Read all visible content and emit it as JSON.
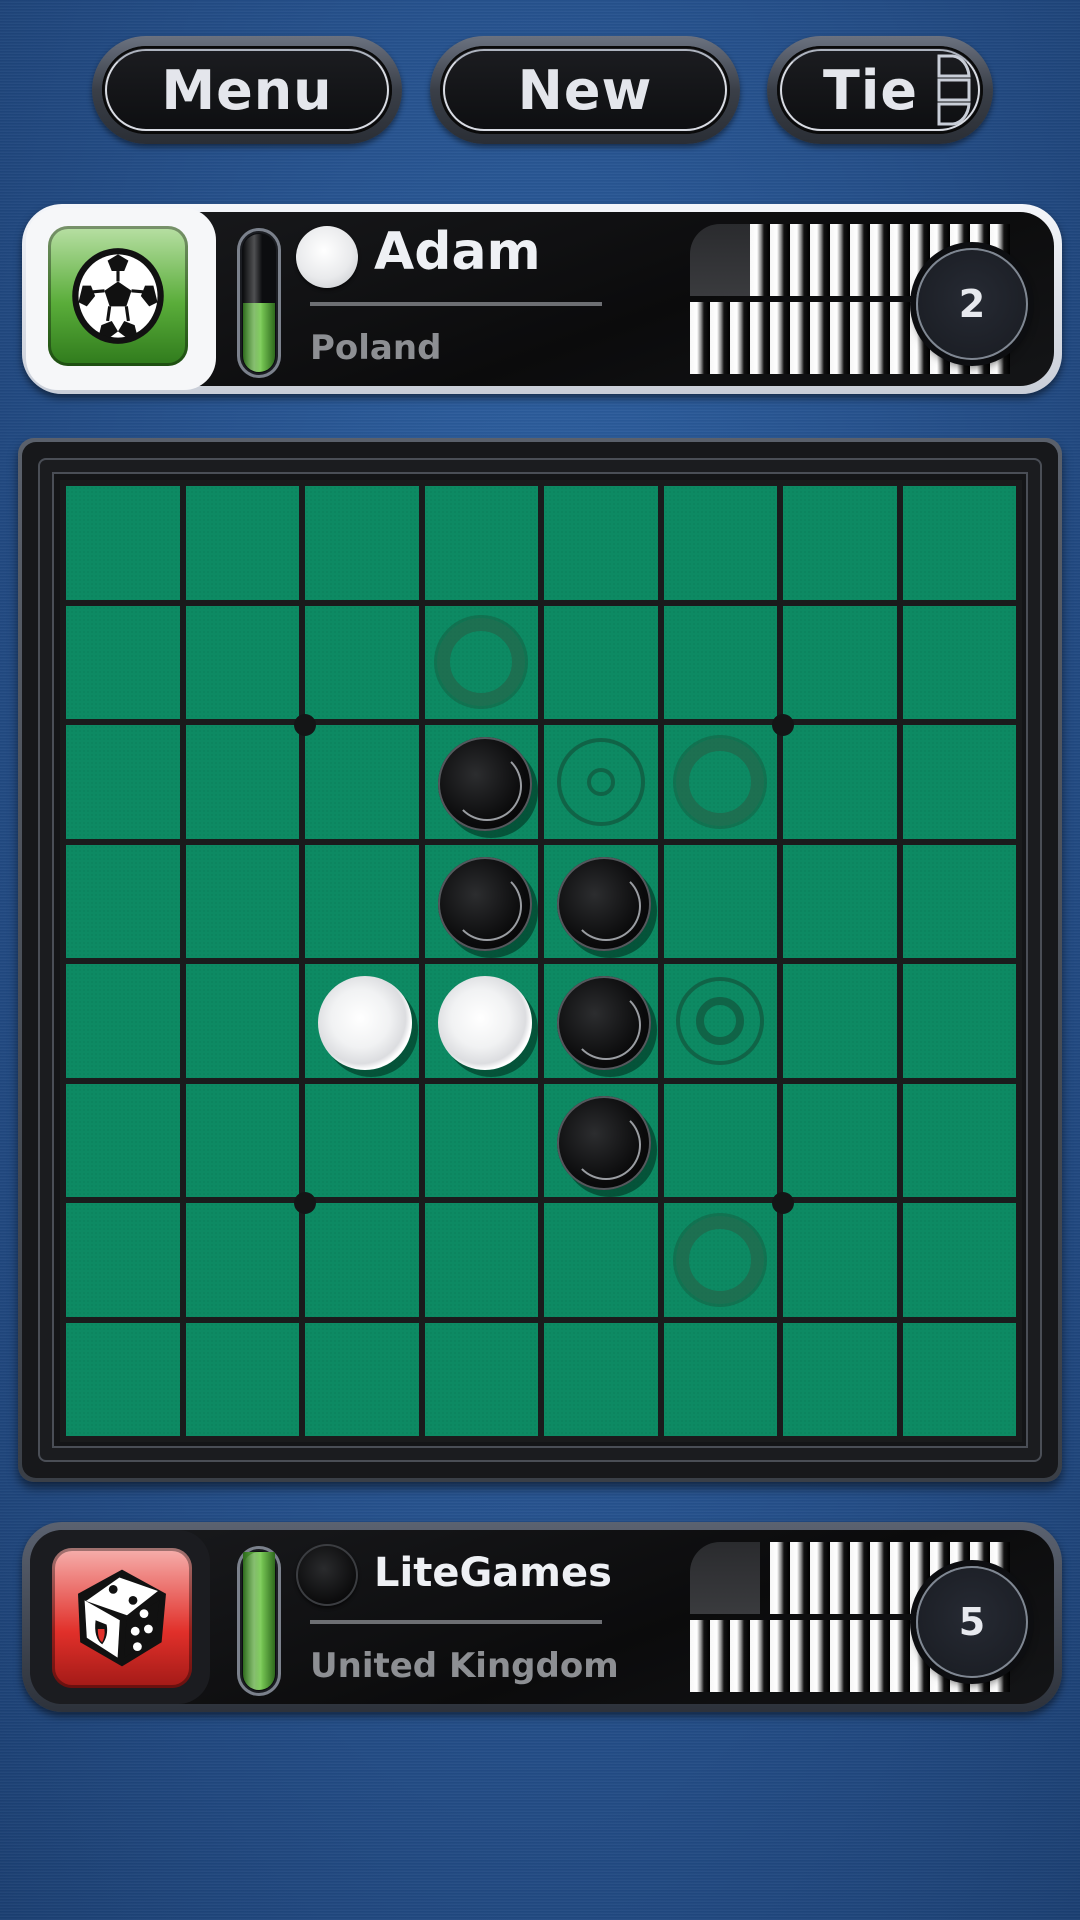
{
  "toolbar": {
    "menu_label": "Menu",
    "new_label": "New",
    "tie_label": "Tie",
    "tie_icon": "film-strip-icon"
  },
  "player": {
    "name": "Adam",
    "country": "Poland",
    "avatar_icon": "soccer-ball-icon",
    "avatar_color": "#5aad3a",
    "disc_color": "white",
    "score": "2",
    "time_fraction": 0.5,
    "active": true,
    "stack_top_count": 13,
    "stack_bottom_count": 16
  },
  "opponent": {
    "name": "LiteGames",
    "country": "United Kingdom",
    "avatar_icon": "dice-icon",
    "avatar_color": "#e1302a",
    "disc_color": "black",
    "score": "5",
    "time_fraction": 1.0,
    "active": false,
    "stack_top_count": 12,
    "stack_bottom_count": 16
  },
  "board": {
    "size": 8,
    "cell_color": "#0d8a63",
    "legend": "W = white, B = black, . = empty, h = hint (thick ring), d = hint (ring with dot), r = hint (ring with inner ring)",
    "rows": [
      "........",
      "...h....",
      "...Bdh..",
      "...BB...",
      "..WWBr..",
      "....B...",
      ".....h..",
      "........"
    ],
    "star_points": [
      [
        2,
        2
      ],
      [
        2,
        6
      ],
      [
        6,
        2
      ],
      [
        6,
        6
      ]
    ]
  }
}
